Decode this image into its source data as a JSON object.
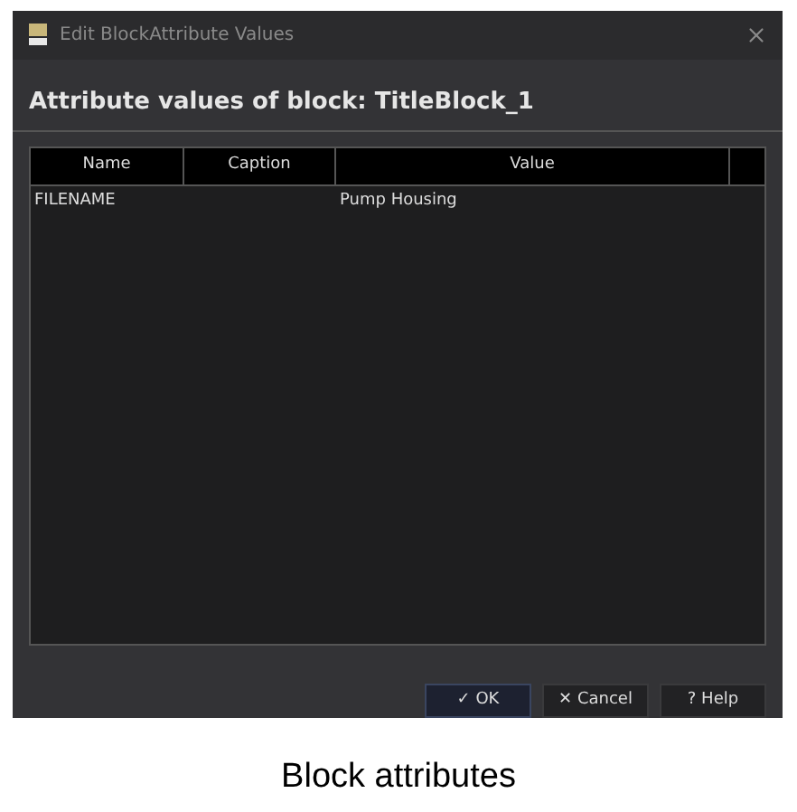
{
  "window": {
    "title": "Edit BlockAttribute Values"
  },
  "heading": "Attribute values of block: TitleBlock_1",
  "table": {
    "columns": [
      "Name",
      "Caption",
      "Value"
    ],
    "rows": [
      {
        "name": "FILENAME",
        "value": "Pump Housing"
      }
    ]
  },
  "buttons": [
    {
      "label": "✓ OK",
      "selected": true
    },
    {
      "label": "✕ Cancel",
      "selected": false
    },
    {
      "label": "? Help",
      "selected": false
    }
  ],
  "caption": "Block attributes"
}
